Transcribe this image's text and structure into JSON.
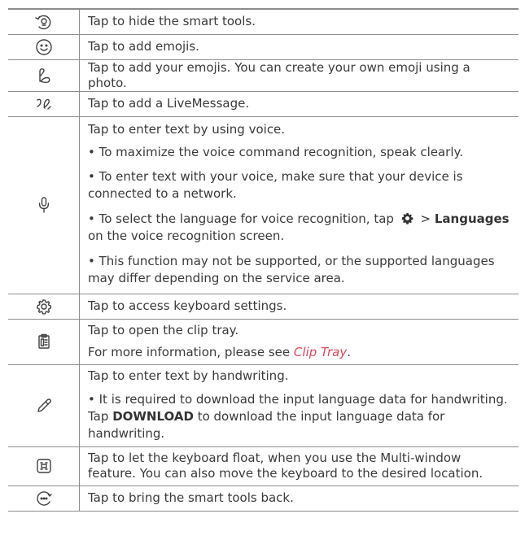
{
  "rows": [
    {
      "icon": "smart-tools-hide-icon",
      "text": "Tap to hide the smart tools."
    },
    {
      "icon": "emoji-smiley-icon",
      "text": "Tap to add emojis."
    },
    {
      "icon": "custom-emoji-icon",
      "text": "Tap to add your emojis. You can create your own emoji using a photo."
    },
    {
      "icon": "livemessage-icon",
      "text": "Tap to add a LiveMessage."
    },
    {
      "icon": "microphone-icon",
      "intro": "Tap to enter text by using voice.",
      "bullet1": "• To maximize the voice command recognition, speak clearly.",
      "bullet2": "• To enter text with your voice, make sure that your device is connected to a network.",
      "bullet3_pre": "• To select the language for voice recognition, tap",
      "bullet3_sep": ">",
      "bullet3_bold": "Languages",
      "bullet3_post": "on the voice recognition screen.",
      "bullet4": "• This function may not be supported, or the supported languages may differ depending on the service area.",
      "inline_icon": "settings-gear-icon"
    },
    {
      "icon": "keyboard-settings-icon",
      "text": "Tap to access keyboard settings."
    },
    {
      "icon": "clip-tray-icon",
      "text": "Tap to open the clip tray.",
      "more_pre": "For more information, please see",
      "more_link": "Clip Tray",
      "more_post": "."
    },
    {
      "icon": "pen-handwriting-icon",
      "intro": "Tap to enter text by handwriting.",
      "bullet_pre": "• It is required to download the input language data for handwriting. Tap",
      "bullet_bold": "DOWNLOAD",
      "bullet_post": "to download the input language data for handwriting."
    },
    {
      "icon": "floating-keyboard-icon",
      "text": "Tap to let the keyboard float, when you use the Multi-window feature. You can also move the keyboard to the desired location."
    },
    {
      "icon": "smart-tools-show-icon",
      "text": "Tap to bring the smart tools back."
    }
  ]
}
